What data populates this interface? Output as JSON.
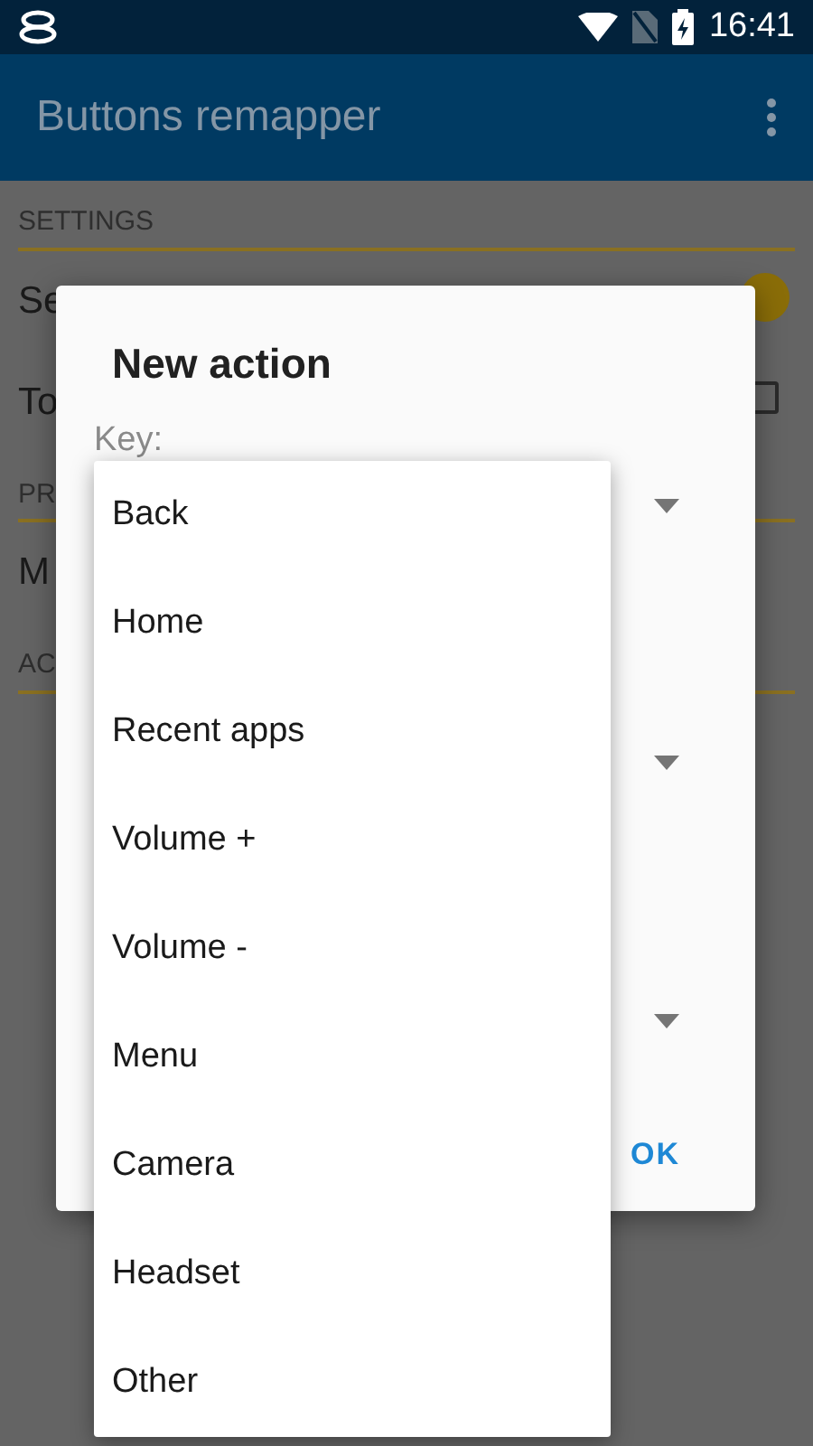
{
  "status_bar": {
    "time": "16:41"
  },
  "app_bar": {
    "title": "Buttons remapper"
  },
  "sections": [
    {
      "header": "SETTINGS",
      "rows": [
        {
          "kind": "switch",
          "label": "Se",
          "on": true
        },
        {
          "kind": "checkbox",
          "label": "To",
          "checked": false
        }
      ]
    },
    {
      "header": "PR",
      "rows": [
        {
          "kind": "text",
          "label": "M"
        }
      ]
    },
    {
      "header": "AC"
    }
  ],
  "dialog": {
    "title": "New action",
    "key_label": "Key:",
    "button": "OK"
  },
  "menu": {
    "items": [
      {
        "label": "Back"
      },
      {
        "label": "Home"
      },
      {
        "label": "Recent apps"
      },
      {
        "label": "Volume +"
      },
      {
        "label": "Volume -"
      },
      {
        "label": "Menu"
      },
      {
        "label": "Camera"
      },
      {
        "label": "Headset"
      },
      {
        "label": "Other"
      }
    ]
  }
}
